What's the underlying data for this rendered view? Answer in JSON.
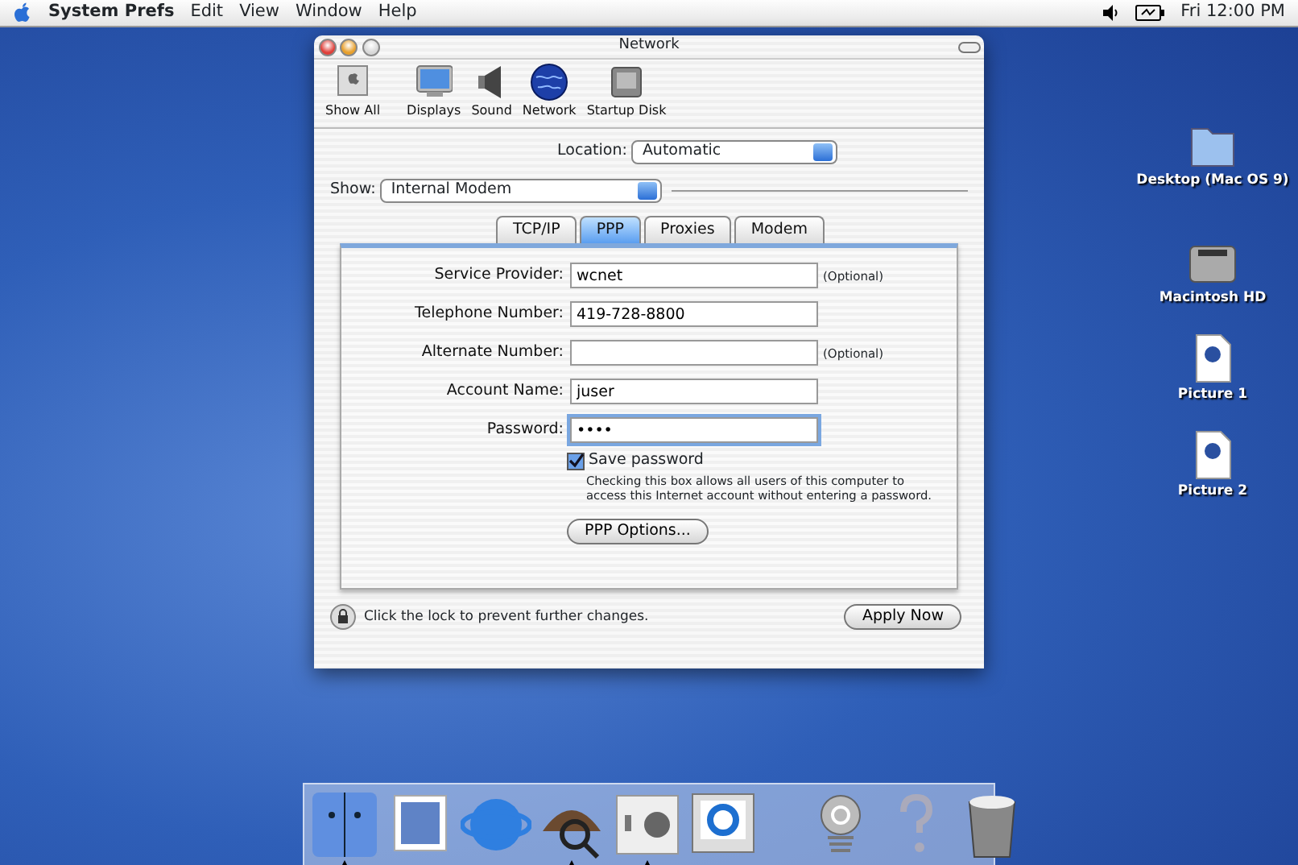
{
  "menubar": {
    "app_name": "System Prefs",
    "items": [
      "Edit",
      "View",
      "Window",
      "Help"
    ],
    "clock": "Fri 12:00 PM"
  },
  "window": {
    "title": "Network",
    "toolbar": [
      {
        "label": "Show All",
        "kind": "showall"
      },
      {
        "label": "Displays",
        "kind": "display"
      },
      {
        "label": "Sound",
        "kind": "speaker"
      },
      {
        "label": "Network",
        "kind": "globe"
      },
      {
        "label": "Startup Disk",
        "kind": "disk"
      }
    ],
    "location": {
      "label": "Location:",
      "value": "Automatic"
    },
    "show": {
      "label": "Show:",
      "value": "Internal Modem"
    },
    "tabs": [
      {
        "label": "TCP/IP",
        "selected": false
      },
      {
        "label": "PPP",
        "selected": true
      },
      {
        "label": "Proxies",
        "selected": false
      },
      {
        "label": "Modem",
        "selected": false
      }
    ],
    "fields": [
      {
        "label": "Service Provider:",
        "value": "wcnet",
        "note": "(Optional)",
        "focused": false
      },
      {
        "label": "Telephone Number:",
        "value": "419-728-8800",
        "focused": false
      },
      {
        "label": "Alternate Number:",
        "note": "(Optional)",
        "focused": false
      },
      {
        "label": "Account Name:",
        "value": "juser",
        "focused": false
      },
      {
        "label": "Password:",
        "value": "••••",
        "focused": true
      }
    ],
    "save_password": {
      "label": "Save password",
      "checked": true,
      "description": "Checking this box allows all users of this computer to access this Internet account without entering a password."
    },
    "options_button": "PPP Options...",
    "lock_text": "Click the lock to prevent further changes.",
    "apply_button": "Apply Now"
  },
  "desktop_icons": [
    {
      "label": "Desktop (Mac OS 9)",
      "kind": "folder"
    },
    {
      "label": "Macintosh HD",
      "kind": "disk"
    },
    {
      "label": "Picture 1",
      "kind": "tif"
    },
    {
      "label": "Picture 2",
      "kind": "tif"
    }
  ],
  "dock": [
    {
      "kind": "finder",
      "running": true
    },
    {
      "kind": "mail",
      "running": false
    },
    {
      "kind": "browser",
      "running": false
    },
    {
      "kind": "sherlock",
      "running": true
    },
    {
      "kind": "prefs",
      "running": true
    },
    {
      "kind": "quicktime",
      "running": false
    },
    {
      "kind": "at",
      "running": false
    },
    {
      "kind": "help",
      "running": false
    },
    {
      "kind": "trash",
      "running": false
    }
  ]
}
